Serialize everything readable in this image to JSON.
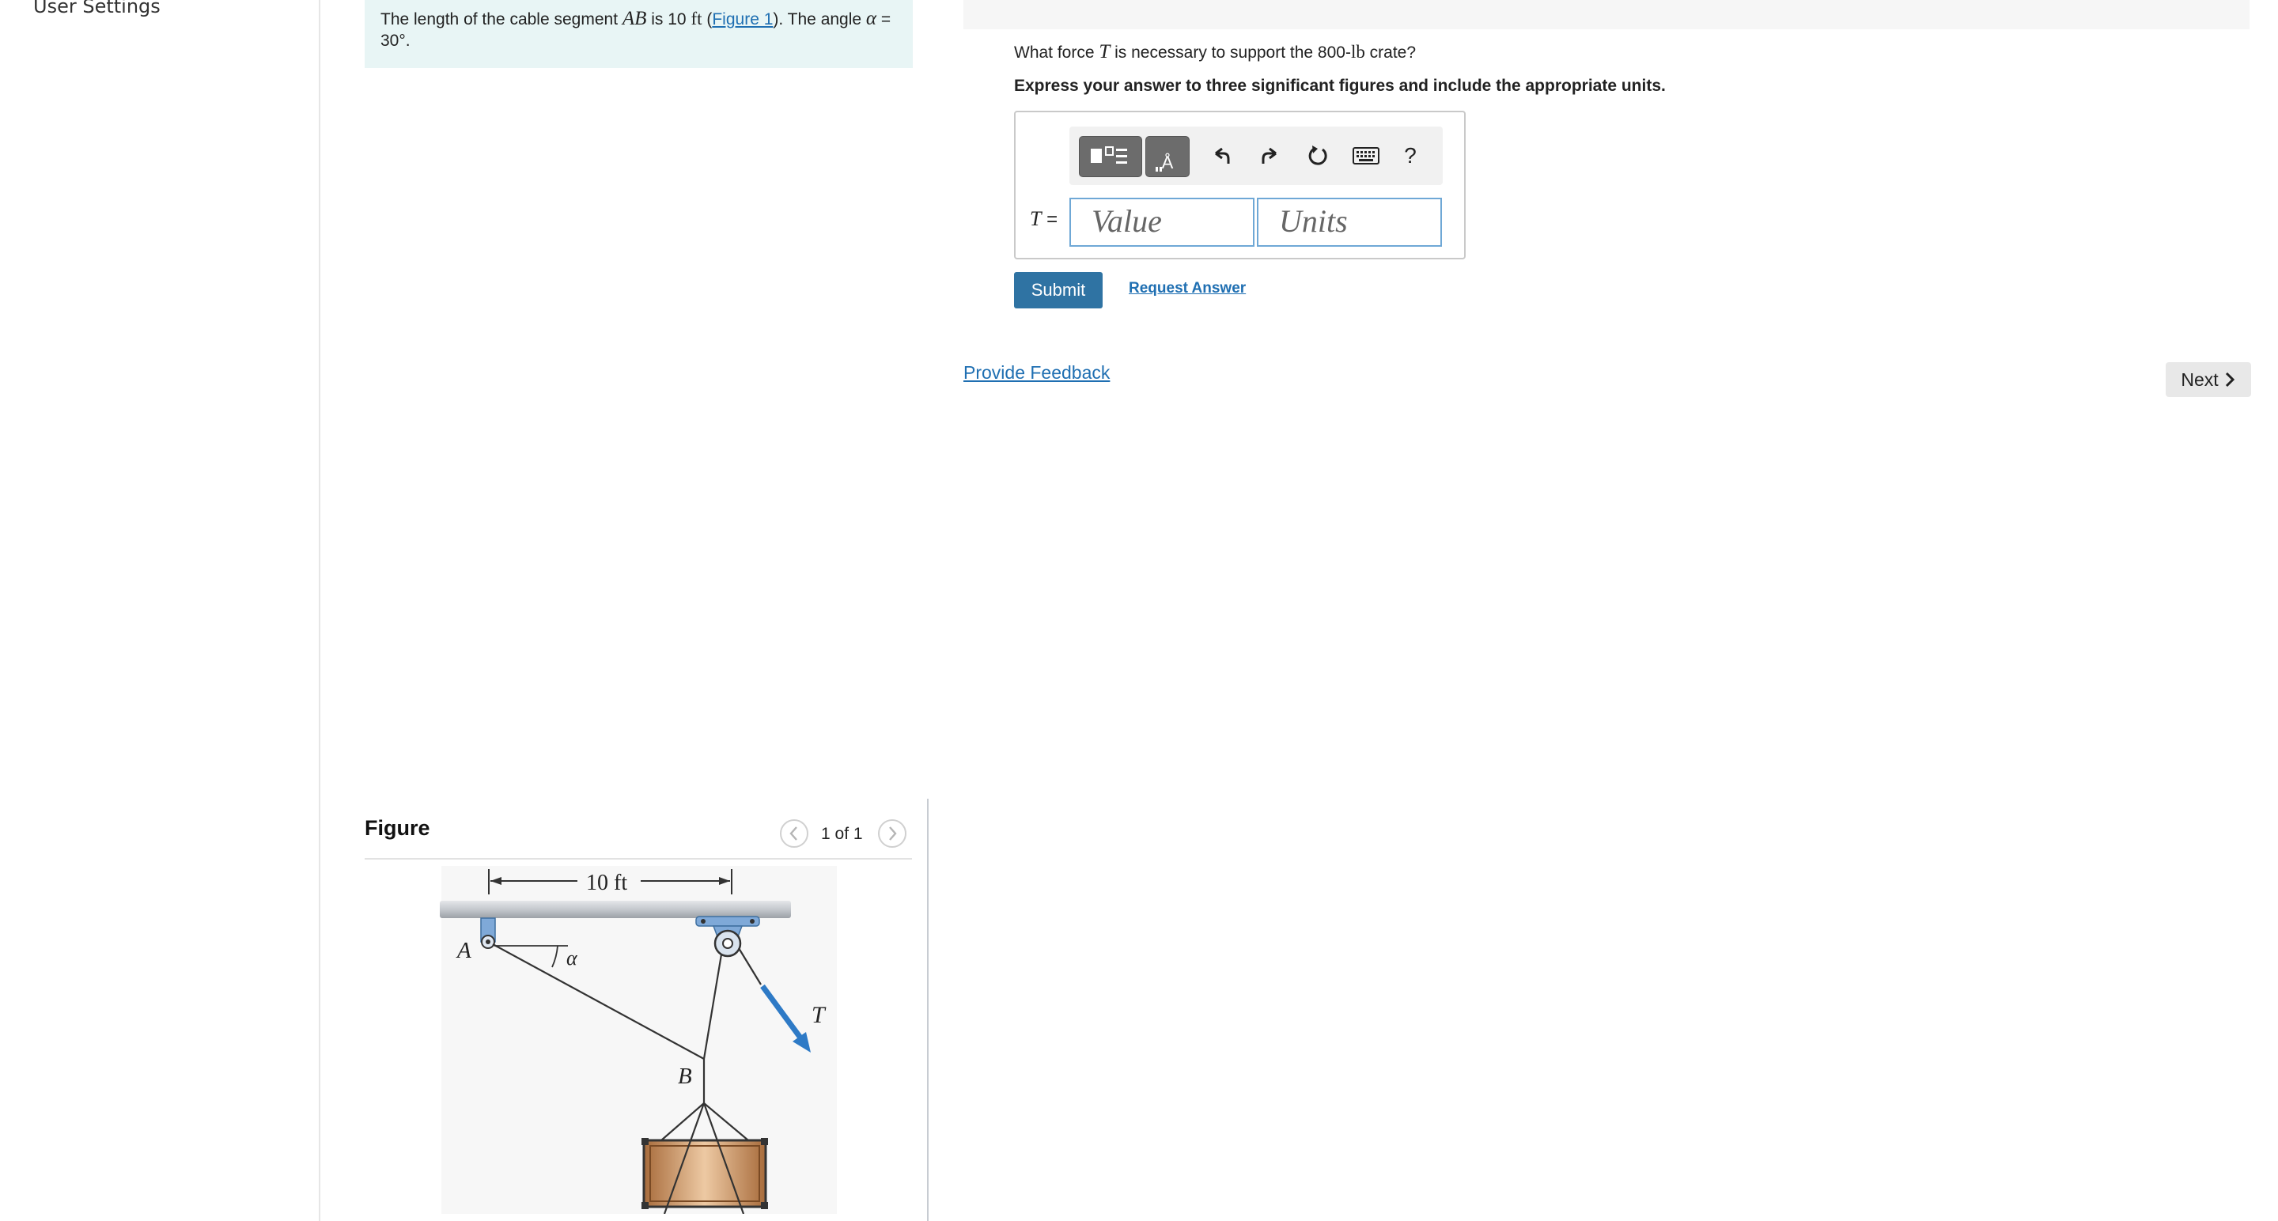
{
  "nav": {
    "user_settings": "User Settings"
  },
  "problem": {
    "text_1": "The length of the cable segment ",
    "math_ab": "AB",
    "text_2": " is 10 ",
    "unit_ft": "ft",
    "text_3": " (",
    "figure_link": "Figure 1",
    "text_4": "). The angle ",
    "alpha": "α",
    "text_5": " = 30°."
  },
  "figure": {
    "title": "Figure",
    "pager": "1 of 1",
    "prev_icon": "chevron-left-icon",
    "next_icon": "chevron-right-icon",
    "labels": {
      "dim": "10 ft",
      "A": "A",
      "B": "B",
      "alpha": "α",
      "T": "T"
    },
    "colors": {
      "beam": "#c9cdd2",
      "bracket": "#7fa9d8",
      "force_arrow": "#2e7ac6",
      "crate": "#c98f5a"
    }
  },
  "question": {
    "text_1": "What force ",
    "var": "T",
    "text_2": " is necessary to support the 800-",
    "unit_lb": "lb",
    "text_3": " crate?",
    "instruction": "Express your answer to three significant figures and include the appropriate units."
  },
  "answer": {
    "label": "T =",
    "value_placeholder": "Value",
    "units_placeholder": "Units",
    "toolbar": [
      "templates-icon",
      "units-icon",
      "undo-icon",
      "redo-icon",
      "reset-icon",
      "keyboard-icon",
      "help-icon"
    ],
    "help_glyph": "?"
  },
  "actions": {
    "submit": "Submit",
    "request_answer": "Request Answer",
    "feedback": "Provide Feedback",
    "next": "Next"
  },
  "colors": {
    "accent": "#2f73a3",
    "link": "#1f6fb2",
    "problem_bg": "#e8f5f5"
  }
}
